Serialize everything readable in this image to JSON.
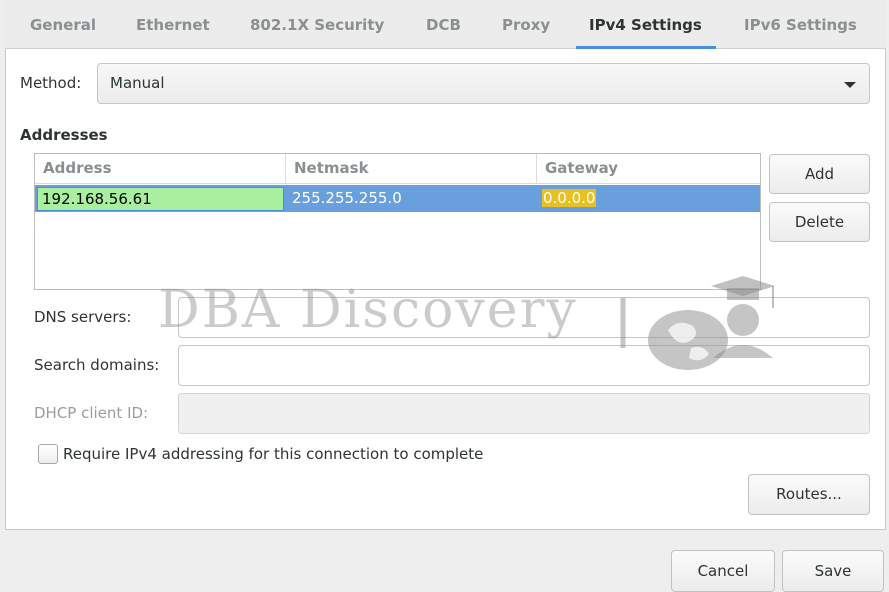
{
  "tabs": [
    {
      "label": "General",
      "active": false
    },
    {
      "label": "Ethernet",
      "active": false
    },
    {
      "label": "802.1X Security",
      "active": false
    },
    {
      "label": "DCB",
      "active": false
    },
    {
      "label": "Proxy",
      "active": false
    },
    {
      "label": "IPv4 Settings",
      "active": true
    },
    {
      "label": "IPv6 Settings",
      "active": false
    }
  ],
  "method": {
    "label": "Method:",
    "value": "Manual"
  },
  "addresses": {
    "heading": "Addresses",
    "columns": [
      "Address",
      "Netmask",
      "Gateway"
    ],
    "rows": [
      {
        "address": "192.168.56.61",
        "netmask": "255.255.255.0",
        "gateway": "0.0.0.0"
      }
    ],
    "add_label": "Add",
    "delete_label": "Delete"
  },
  "dns": {
    "label": "DNS servers:",
    "value": ""
  },
  "search_domains": {
    "label": "Search domains:",
    "value": ""
  },
  "dhcp_client_id": {
    "label": "DHCP client ID:",
    "value": ""
  },
  "require_ipv4": {
    "label": "Require IPv4 addressing for this connection to complete",
    "checked": false
  },
  "routes_label": "Routes...",
  "footer": {
    "cancel_label": "Cancel",
    "save_label": "Save"
  },
  "watermark": {
    "text": "DBA Discovery"
  },
  "colors": {
    "accent": "#4a90d9",
    "selection": "#6a9fdd",
    "edit_cell": "#a8f0a0",
    "gateway_highlight": "#e8c020"
  }
}
